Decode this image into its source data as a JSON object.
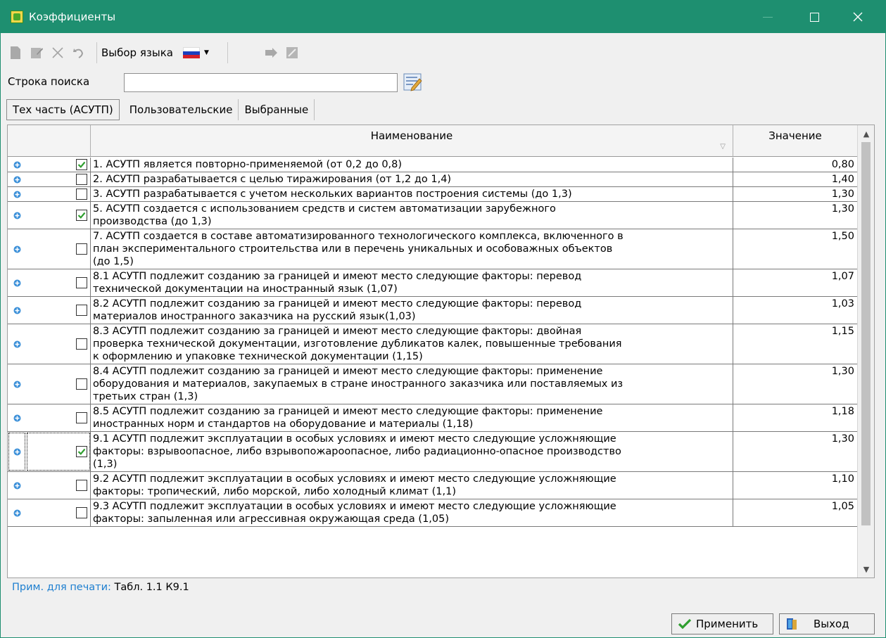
{
  "window": {
    "title": "Коэффициенты"
  },
  "toolbar": {
    "language_label": "Выбор языка"
  },
  "search": {
    "label": "Строка поиска",
    "value": ""
  },
  "tabs": [
    {
      "label": "Тех часть (АСУТП)",
      "active": true
    },
    {
      "label": "Пользовательские",
      "active": false
    },
    {
      "label": "Выбранные",
      "active": false
    }
  ],
  "grid": {
    "columns": {
      "name": "Наименование",
      "value": "Значение"
    },
    "rows": [
      {
        "checked": true,
        "name": "1. АСУТП является повторно-применяемой (от 0,2 до 0,8)",
        "value": "0,80"
      },
      {
        "checked": false,
        "name": "2. АСУТП разрабатывается с целью тиражирования (от 1,2 до 1,4)",
        "value": "1,40"
      },
      {
        "checked": false,
        "name": "3. АСУТП разрабатывается с учетом нескольких вариантов построения системы (до 1,3)",
        "value": "1,30"
      },
      {
        "checked": true,
        "name": "5. АСУТП создается с использованием средств и систем автоматизации зарубежного\nпроизводства (до 1,3)",
        "value": "1,30"
      },
      {
        "checked": false,
        "name": "7. АСУТП создается в составе автоматизированного технологического комплекса, включенного в\nплан экспериментального строительства или в перечень уникальных и особоважных объектов\n(до 1,5)",
        "value": "1,50"
      },
      {
        "checked": false,
        "name": "8.1 АСУТП подлежит созданию за границей и имеют место следующие факторы: перевод\nтехнической документации на иностранный язык (1,07)",
        "value": "1,07"
      },
      {
        "checked": false,
        "name": "8.2 АСУТП подлежит созданию за границей и имеют место следующие факторы: перевод\nматериалов иностранного заказчика на русский язык(1,03)",
        "value": "1,03"
      },
      {
        "checked": false,
        "name": "8.3 АСУТП подлежит созданию за границей и имеют место следующие факторы: двойная\nпроверка технической документации, изготовление дубликатов калек, повышенные требования\nк оформлению и упаковке технической документации (1,15)",
        "value": "1,15"
      },
      {
        "checked": false,
        "name": "8.4 АСУТП подлежит созданию за границей и имеют место следующие факторы: применение\nоборудования и материалов, закупаемых в стране иностранного заказчика или поставляемых из\nтретьих стран (1,3)",
        "value": "1,30"
      },
      {
        "checked": false,
        "name": "8.5 АСУТП подлежит созданию за границей и имеют место следующие факторы: применение\nиностранных норм и стандартов на оборудование и материалы (1,18)",
        "value": "1,18"
      },
      {
        "checked": true,
        "name": "9.1 АСУТП подлежит эксплуатации в особых условиях и имеют место следующие усложняющие\nфакторы: взрывоопасное, либо взрывопожароопасное, либо радиационно-опасное производство\n(1,3)",
        "value": "1,30",
        "focused": true
      },
      {
        "checked": false,
        "name": "9.2 АСУТП подлежит эксплуатации в особых условиях и имеют место следующие усложняющие\nфакторы: тропический, либо морской, либо холодный климат (1,1)",
        "value": "1,10"
      },
      {
        "checked": false,
        "name": "9.3 АСУТП подлежит эксплуатации в особых условиях и имеют место следующие усложняющие\nфакторы: запыленная или агрессивная окружающая среда (1,05)",
        "value": "1,05"
      }
    ]
  },
  "note": {
    "label": "Прим. для печати:",
    "value": "Табл. 1.1 К9.1"
  },
  "buttons": {
    "apply": "Применить",
    "exit": "Выход"
  },
  "colors": {
    "titlebar": "#1e8f70",
    "note_label": "#1e7fd0",
    "check": "#2e9e2e"
  }
}
